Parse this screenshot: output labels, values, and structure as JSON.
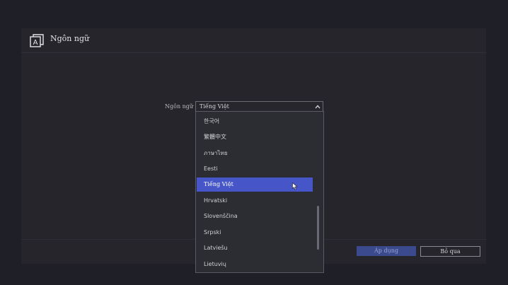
{
  "dialog": {
    "title": "Ngôn ngữ",
    "icon": "language-icon"
  },
  "language_field": {
    "label": "Ngôn ngữ",
    "value": "Tiếng Việt"
  },
  "dropdown": {
    "options": [
      "한국어",
      "繁體中文",
      "ภาษาไทย",
      "Eesti",
      "Tiếng Việt",
      "Hrvatski",
      "Slovenščina",
      "Srpski",
      "Latviešu",
      "Lietuvių"
    ],
    "selected": "Tiếng Việt"
  },
  "buttons": {
    "apply": "Áp dụng",
    "skip": "Bỏ qua"
  },
  "colors": {
    "accent": "#4655c7",
    "background": "#1f1f27",
    "panel": "#25252b"
  }
}
